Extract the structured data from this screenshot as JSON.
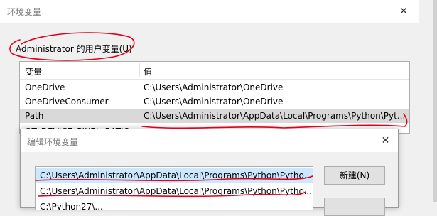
{
  "window": {
    "title": "环境变量",
    "close_glyph": "✕"
  },
  "user_vars": {
    "label": "Administrator 的用户变量(U)",
    "columns": {
      "name": "变量",
      "value": "值"
    },
    "rows": [
      {
        "name": "OneDrive",
        "value": "C:\\Users\\Administrator\\OneDrive"
      },
      {
        "name": "OneDriveConsumer",
        "value": "C:\\Users\\Administrator\\OneDrive"
      },
      {
        "name": "Path",
        "value": "C:\\Users\\Administrator\\AppData\\Local\\Programs\\Python\\Pyt..."
      },
      {
        "name": "QT_DEVICE_PIXEL_RATIO",
        "value": ""
      }
    ]
  },
  "edit_dialog": {
    "title": "编辑环境变量",
    "close_glyph": "✕",
    "entries": [
      "C:\\Users\\Administrator\\AppData\\Local\\Programs\\Python\\Pytho...",
      "C:\\Users\\Administrator\\AppData\\Local\\Programs\\Python\\Pytho...",
      "C:\\Python27\\..."
    ],
    "new_button": "新建(N)"
  },
  "colors": {
    "annotation": "#e0001b",
    "selected_row": "#d9d9d9",
    "dialog_selected": "#cce8ff"
  }
}
